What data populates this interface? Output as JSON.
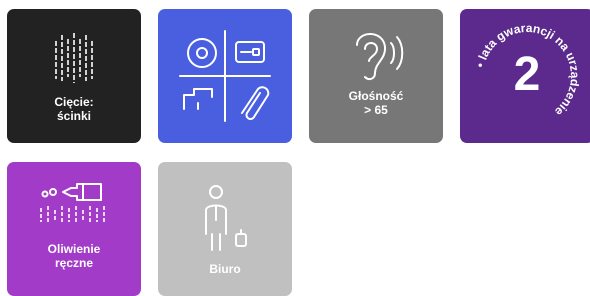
{
  "tiles": [
    {
      "id": "cutting",
      "color": "#222222",
      "icon": "cutting-lines-icon",
      "line1": "Cięcie:",
      "line2": "ścinki"
    },
    {
      "id": "features",
      "color": "#4a5fe0",
      "icon": "office-features-grid-icon"
    },
    {
      "id": "loudness",
      "color": "#777777",
      "icon": "ear-sound-icon",
      "line1": "Głośność",
      "line2": "> 65"
    },
    {
      "id": "warranty",
      "color": "#5b2a8c",
      "icon": "warranty-badge-icon",
      "number": "2",
      "ring_text": "• lata gwarancji na urządzenie"
    },
    {
      "id": "oiling",
      "color": "#a23cc8",
      "icon": "oil-bottle-icon",
      "line1": "Oliwienie",
      "line2": "ręczne"
    },
    {
      "id": "office",
      "color": "#c0c0c0",
      "icon": "office-person-icon",
      "line1": "Biuro"
    }
  ]
}
